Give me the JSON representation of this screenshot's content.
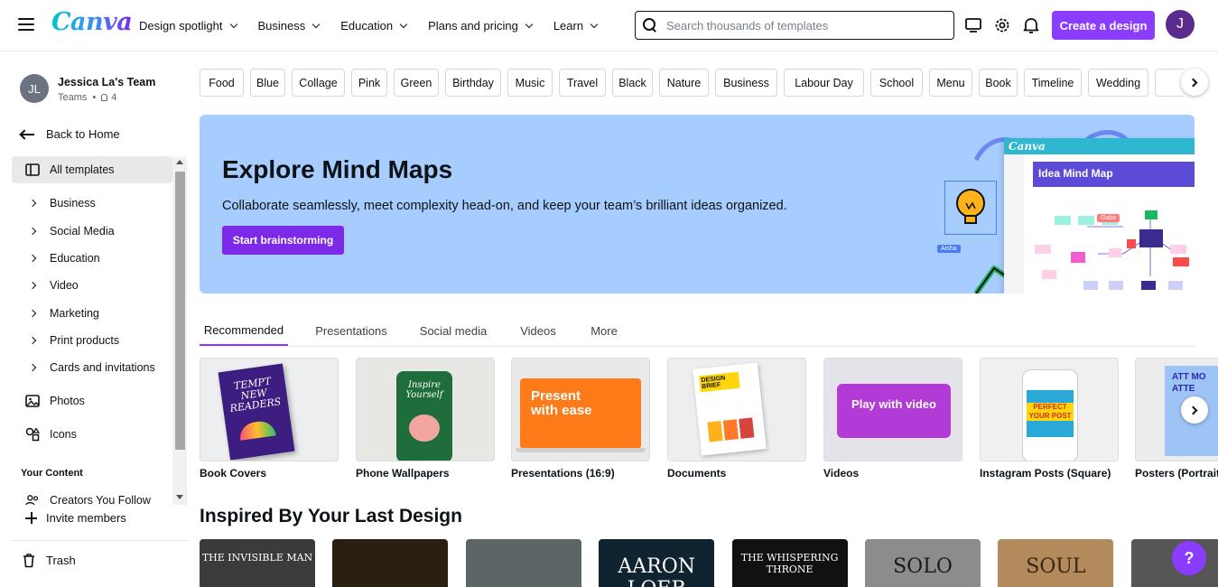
{
  "header": {
    "logo": "Canva",
    "nav": [
      "Design spotlight",
      "Business",
      "Education",
      "Plans and pricing",
      "Learn"
    ],
    "search_placeholder": "Search thousands of templates",
    "create_label": "Create a design",
    "user_initial": "J"
  },
  "sidebar": {
    "team_initials": "JL",
    "team_name": "Jessica La's Team",
    "team_type": "Teams",
    "member_count": "4",
    "back_label": "Back to Home",
    "items": [
      {
        "label": "All templates"
      },
      {
        "label": "Business"
      },
      {
        "label": "Social Media"
      },
      {
        "label": "Education"
      },
      {
        "label": "Video"
      },
      {
        "label": "Marketing"
      },
      {
        "label": "Print products"
      },
      {
        "label": "Cards and invitations"
      },
      {
        "label": "Photos"
      },
      {
        "label": "Icons"
      }
    ],
    "your_content_heading": "Your Content",
    "creators_label": "Creators You Follow",
    "invite_label": "Invite members",
    "trash_label": "Trash"
  },
  "chips": [
    "Food",
    "Blue",
    "Collage",
    "Pink",
    "Green",
    "Birthday",
    "Music",
    "Travel",
    "Black",
    "Nature",
    "Business",
    "Labour Day",
    "School",
    "Menu",
    "Book",
    "Timeline",
    "Wedding"
  ],
  "banner": {
    "title": "Explore Mind Maps",
    "subtitle": "Collaborate seamlessly, meet complexity head-on, and keep your team’s brilliant ideas organized.",
    "button": "Start brainstorming",
    "canvas_logo": "Canva",
    "canvas_title": "Idea Mind Map",
    "tag_aisha": "Aisha",
    "tag_gabe": "Gabe"
  },
  "tabs": [
    "Recommended",
    "Presentations",
    "Social media",
    "Videos",
    "More"
  ],
  "categories": [
    {
      "label": "Book Covers",
      "thumb_text": "TEMPT NEW READERS"
    },
    {
      "label": "Phone Wallpapers",
      "thumb_text": "Inspire Yourself"
    },
    {
      "label": "Presentations (16:9)",
      "thumb_text": "Present with ease"
    },
    {
      "label": "Documents",
      "thumb_text": "DESIGN BRIEF"
    },
    {
      "label": "Videos",
      "thumb_text": "Play with video"
    },
    {
      "label": "Instagram Posts (Square)",
      "thumb_text": "PERFECT YOUR POST"
    },
    {
      "label": "Posters (Portrait)",
      "thumb_text": "ATT MO ATTE"
    }
  ],
  "inspired": {
    "title": "Inspired By Your Last Design",
    "designs": [
      {
        "text": "THE INVISIBLE MAN",
        "color": "#3b3b3b"
      },
      {
        "text": "",
        "color": "#2a1f10"
      },
      {
        "text": "",
        "color": "#5d6567"
      },
      {
        "text": "AARON LOEB",
        "color": "#0f2430"
      },
      {
        "text": "THE WHISPERING THRONE",
        "color": "#111111"
      },
      {
        "text": "SOLO",
        "color": "#8c8c8c"
      },
      {
        "text": "SOUL",
        "color": "#b38a5b"
      },
      {
        "text": "",
        "color": "#565656"
      }
    ]
  },
  "colors": {
    "accent": "#8b3dff",
    "banner_bg": "#a6cdfd",
    "banner_button": "#7d2ae8"
  }
}
